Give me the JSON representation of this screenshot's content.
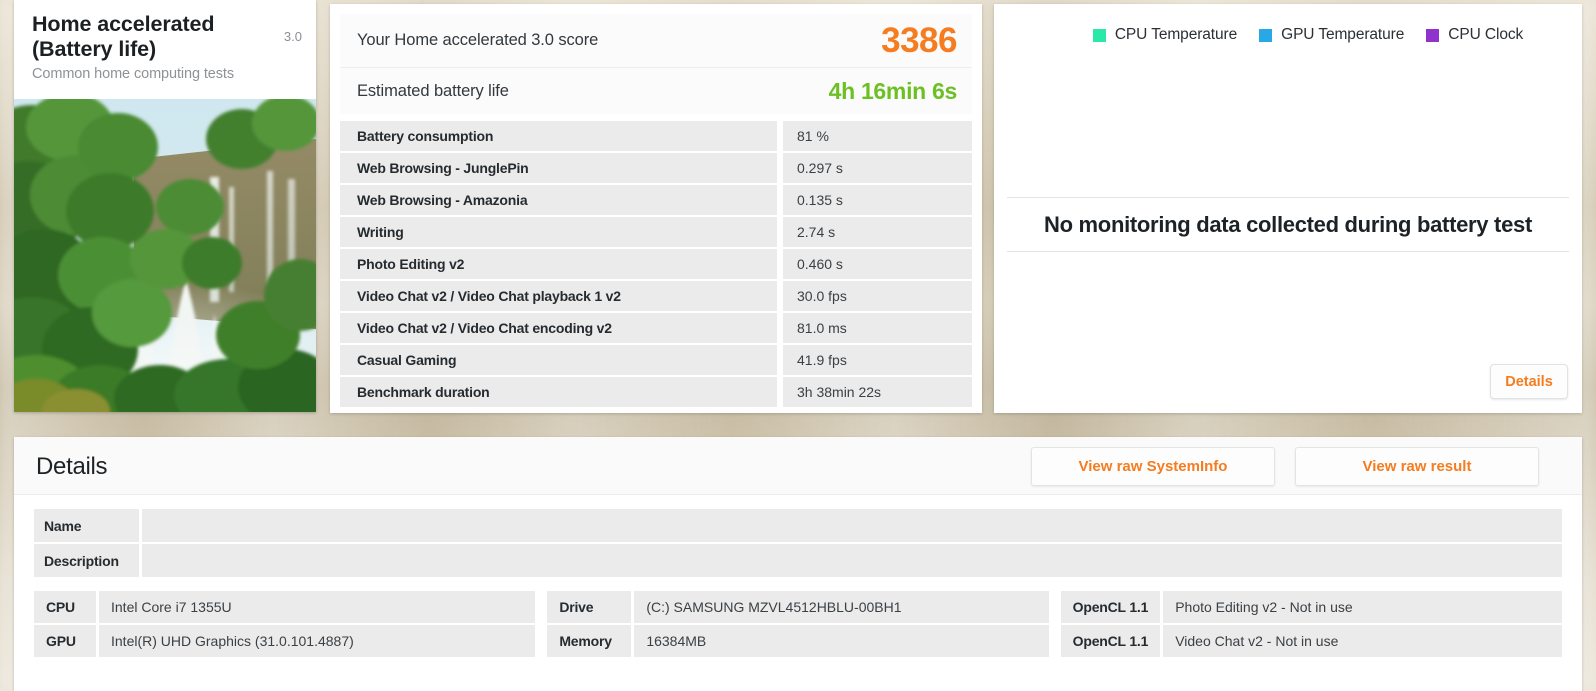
{
  "test_card": {
    "title": "Home accelerated (Battery life)",
    "version": "3.0",
    "subtitle": "Common home computing tests",
    "photo_alt": "jungle-waterfall-photo"
  },
  "score_panel": {
    "score_label": "Your Home accelerated 3.0 score",
    "score_value": "3386",
    "battery_label": "Estimated battery life",
    "battery_value": "4h 16min 6s",
    "results": [
      {
        "name": "Battery consumption",
        "value": "81 %"
      },
      {
        "name": "Web Browsing - JunglePin",
        "value": "0.297 s"
      },
      {
        "name": "Web Browsing - Amazonia",
        "value": "0.135 s"
      },
      {
        "name": "Writing",
        "value": "2.74 s"
      },
      {
        "name": "Photo Editing v2",
        "value": "0.460 s"
      },
      {
        "name": "Video Chat v2 / Video Chat playback 1 v2",
        "value": "30.0 fps"
      },
      {
        "name": "Video Chat v2 / Video Chat encoding v2",
        "value": "81.0 ms"
      },
      {
        "name": "Casual Gaming",
        "value": "41.9 fps"
      },
      {
        "name": "Benchmark duration",
        "value": "3h 38min 22s"
      }
    ]
  },
  "monitor_panel": {
    "legend": [
      {
        "label": "CPU Temperature",
        "color": "#29e8a8"
      },
      {
        "label": "GPU Temperature",
        "color": "#29a8e8"
      },
      {
        "label": "CPU Clock",
        "color": "#8f33cc"
      }
    ],
    "empty_message": "No monitoring data collected during battery test",
    "details_button": "Details"
  },
  "details_panel": {
    "title": "Details",
    "buttons": {
      "raw_systeminfo": "View raw SystemInfo",
      "raw_result": "View raw result"
    },
    "meta": [
      {
        "key": "Name",
        "value": ""
      },
      {
        "key": "Description",
        "value": ""
      }
    ],
    "specs": {
      "column1": [
        {
          "key": "CPU",
          "value": "Intel Core i7 1355U"
        },
        {
          "key": "GPU",
          "value": "Intel(R) UHD Graphics (31.0.101.4887)"
        }
      ],
      "column2": [
        {
          "key": "Drive",
          "value": "(C:) SAMSUNG MZVL4512HBLU-00BH1"
        },
        {
          "key": "Memory",
          "value": "16384MB"
        }
      ],
      "column3": [
        {
          "key": "OpenCL 1.1",
          "value": "Photo Editing v2 - Not in use"
        },
        {
          "key": "OpenCL 1.1",
          "value": "Video Chat v2 - Not in use"
        }
      ]
    }
  },
  "colors": {
    "accent_orange": "#f57c1f",
    "battery_green": "#6cc024",
    "row_grey": "#ebebeb"
  }
}
